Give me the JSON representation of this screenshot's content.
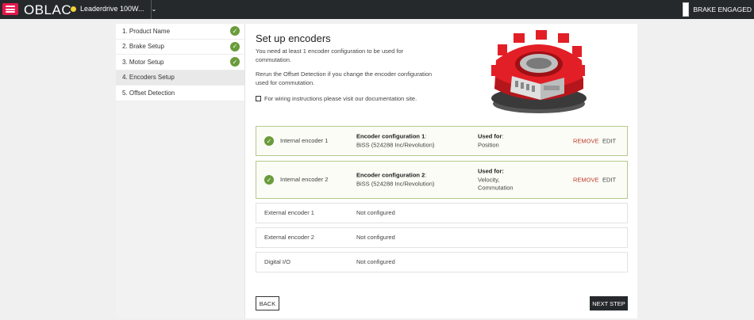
{
  "app": {
    "name": "OBLAC"
  },
  "device": {
    "name": "Leaderdrive 100W...",
    "status_color": "#f2d338"
  },
  "brake": {
    "label": "BRAKE ENGAGED"
  },
  "steps": [
    {
      "label": "1. Product Name",
      "done": true
    },
    {
      "label": "2. Brake Setup",
      "done": true
    },
    {
      "label": "3. Motor Setup",
      "done": true
    },
    {
      "label": "4. Encoders Setup",
      "done": false
    },
    {
      "label": "5. Offset Detection",
      "done": false
    }
  ],
  "main": {
    "title": "Set up encoders",
    "desc1": "You need at least 1 encoder configuration to be used for commutation.",
    "desc2": "Rerun the Offset Detection if you change the encoder configuration used for commutation.",
    "doc_link": "For wiring instructions please visit our documentation site."
  },
  "encoders": {
    "internal1": {
      "name": "Internal encoder 1",
      "config_title": "Encoder configuration 1",
      "config_value": "BiSS (524288 Inc/Revolution)",
      "used_title": "Used for",
      "used_value": "Position",
      "remove": "REMOVE",
      "edit": "EDIT"
    },
    "internal2": {
      "name": "Internal encoder 2",
      "config_title": "Encoder configuration 2",
      "config_value": "BiSS (524288 Inc/Revolution)",
      "used_title": "Used for:",
      "used_value_line1": "Velocity,",
      "used_value_line2": "Commutation",
      "remove": "REMOVE",
      "edit": "EDIT"
    },
    "external1": {
      "name": "External encoder 1",
      "status": "Not configured"
    },
    "external2": {
      "name": "External encoder 2",
      "status": "Not configured"
    },
    "digital": {
      "name": "Digital I/O",
      "status": "Not configured"
    }
  },
  "buttons": {
    "back": "BACK",
    "next": "NEXT STEP"
  },
  "colors": {
    "accent_red": "#e5174c",
    "success_green": "#6a9b3a",
    "topbar": "#26292c",
    "remove_red": "#c0392b"
  }
}
